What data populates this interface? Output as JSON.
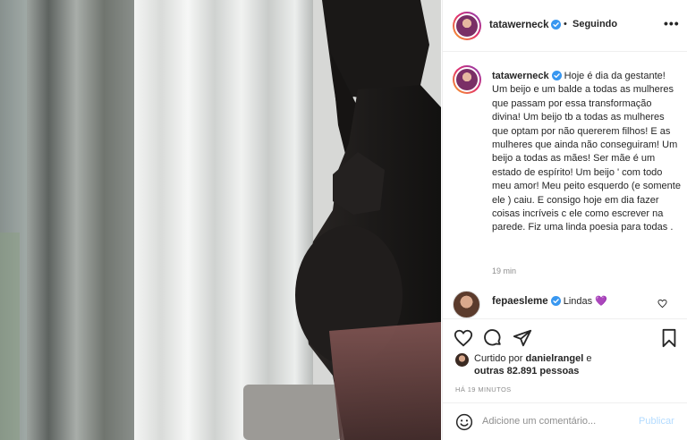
{
  "post": {
    "username": "tatawerneck",
    "verified": true,
    "separator": "•",
    "follow_status": "Seguindo",
    "more_label": "•••"
  },
  "caption": {
    "username": "tatawerneck",
    "text": "Hoje é dia da gestante! Um beijo e um balde a todas as mulheres que passam por essa transformação divina! Um beijo tb a todas as mulheres que optam por não quererem filhos! E as mulheres que ainda não conseguiram! Um beijo a todas as mães! Ser mãe é um estado de espírito! Um beijo ' com todo meu amor! Meu peito esquerdo (e somente ele ) caiu. E consigo hoje em dia fazer coisas incríveis c ele como escrever na parede. Fiz uma linda poesia para todas .",
    "time": "19 min"
  },
  "comments": [
    {
      "username": "fepaesleme",
      "verified": true,
      "text": "Lindas",
      "emoji": "💜"
    }
  ],
  "likes": {
    "prefix": "Curtido por",
    "user": "danielrangel",
    "connector": "e",
    "others": "outras 82.891 pessoas"
  },
  "timestamp": "HÁ 19 MINUTOS",
  "comment_box": {
    "placeholder": "Adicione um comentário...",
    "publish_label": "Publicar"
  },
  "icons": {
    "verified": "verified-badge-icon",
    "like": "heart-icon",
    "comment": "comment-bubble-icon",
    "share": "paper-plane-icon",
    "save": "bookmark-icon",
    "emoji": "emoji-smile-icon"
  },
  "colors": {
    "verified": "#3897f0",
    "text": "#262626",
    "muted": "#8e8e8e",
    "publish_disabled": "#b3dbff",
    "purple_heart": "#8a5cd6"
  }
}
